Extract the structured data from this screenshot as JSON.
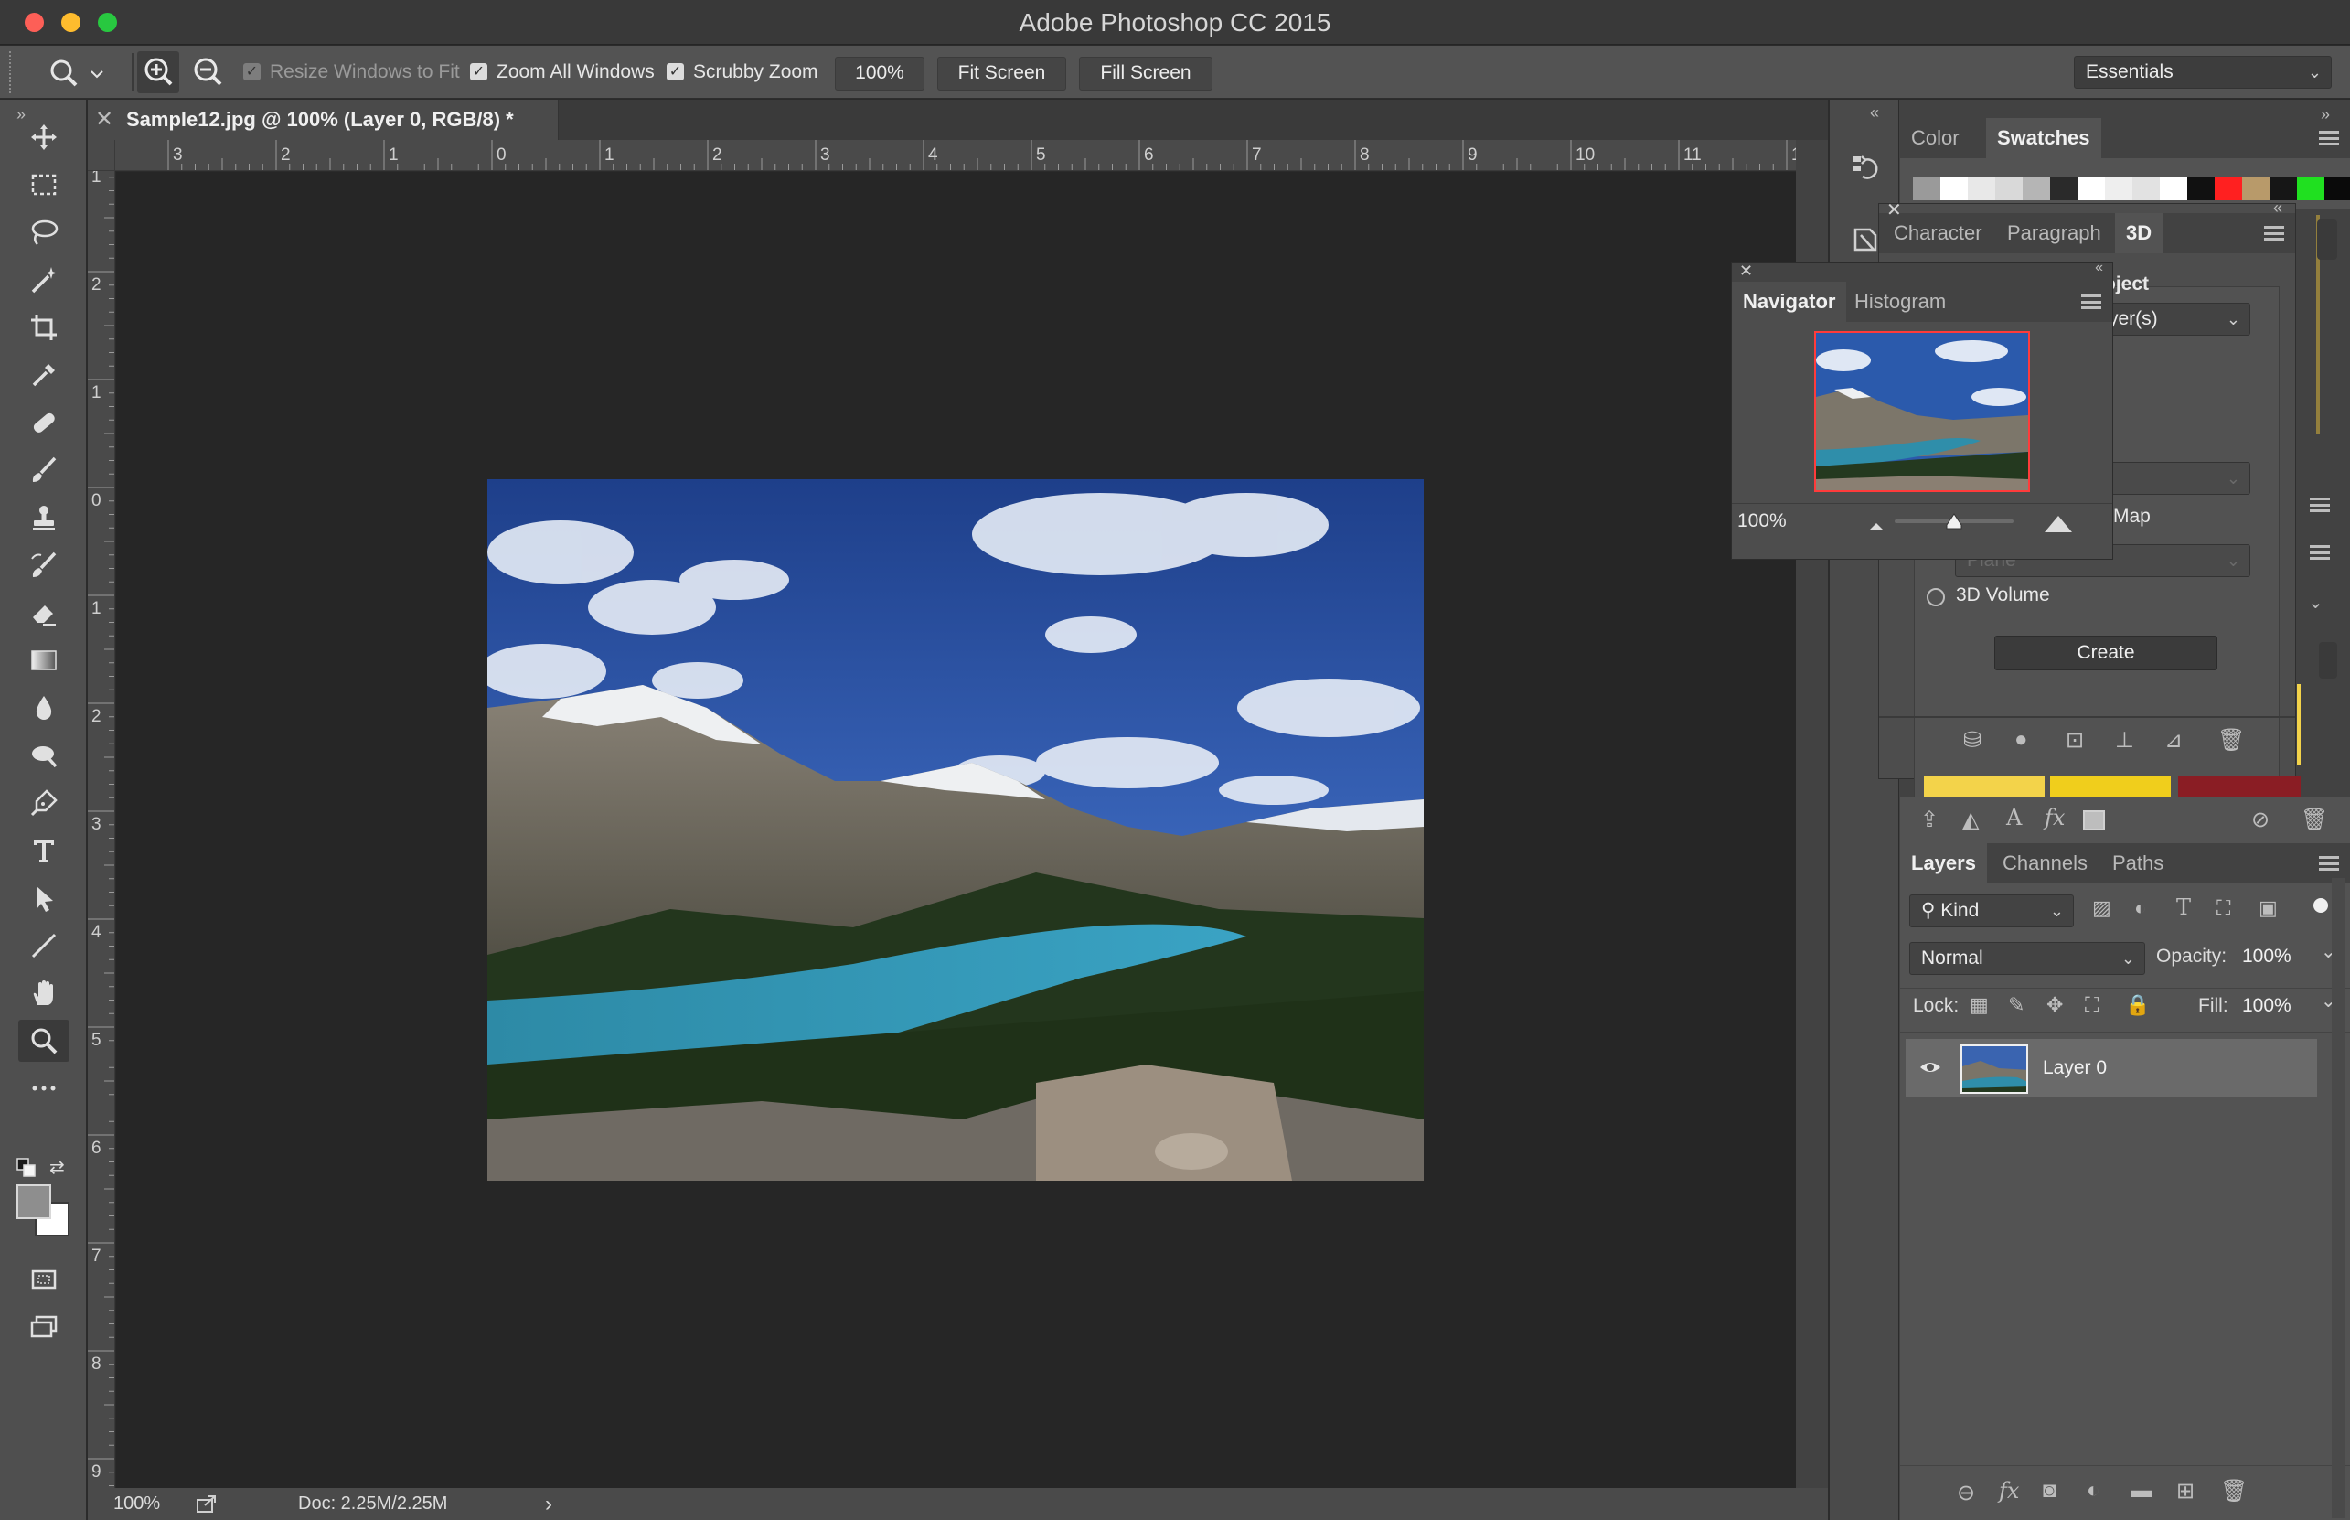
{
  "window": {
    "title": "Adobe Photoshop CC 2015"
  },
  "options_bar": {
    "resize_windows_label": "Resize Windows to Fit",
    "zoom_all_windows_label": "Zoom All Windows",
    "scrubby_zoom_label": "Scrubby Zoom",
    "zoom_value": "100%",
    "fit_screen_label": "Fit Screen",
    "fill_screen_label": "Fill Screen",
    "workspace": "Essentials",
    "resize_windows_checked": true,
    "zoom_all_windows_checked": true,
    "scrubby_zoom_checked": true
  },
  "document": {
    "tab_title": "Sample12.jpg @ 100% (Layer 0, RGB/8) *",
    "ruler_h": [
      "3",
      "2",
      "1",
      "0",
      "1",
      "2",
      "3",
      "4",
      "5",
      "6",
      "7",
      "8",
      "9",
      "10",
      "11",
      "1"
    ],
    "ruler_v": [
      "1",
      "2",
      "1",
      "0",
      "1",
      "2",
      "3",
      "4",
      "5",
      "6",
      "7",
      "8",
      "9"
    ]
  },
  "status_bar": {
    "zoom": "100%",
    "doc_size": "Doc: 2.25M/2.25M",
    "arrow": "›"
  },
  "color_panel": {
    "tabs": [
      "Color",
      "Swatches"
    ],
    "active_tab": "Swatches",
    "swatches": [
      "#9a9a9a",
      "#ffffff",
      "#e8e8e8",
      "#d9d9d9",
      "#b5b5b5",
      "#2a2a2a",
      "#ffffff",
      "#eeeeee",
      "#e2e2e2",
      "#ffffff",
      "#111111",
      "#ff2020",
      "#b89a6a",
      "#161616",
      "#20e020",
      "#0a0a0a"
    ]
  },
  "properties_panel": {
    "tabs": [
      "Character",
      "Paragraph",
      "3D"
    ],
    "active_tab": "3D",
    "object_label": "oject",
    "layers_dropdown": "yer(s)",
    "map_label": "Map",
    "volume_label": "3D Volume",
    "plane_value": "Plane",
    "create_button": "Create"
  },
  "navigator_panel": {
    "tabs": [
      "Navigator",
      "Histogram"
    ],
    "active_tab": "Navigator",
    "zoom": "100%",
    "zoom_slider_percent": 50
  },
  "layers_panel": {
    "tabs": [
      "Layers",
      "Channels",
      "Paths"
    ],
    "active_tab": "Layers",
    "filter_kind": "Kind",
    "blend_mode": "Normal",
    "opacity_label": "Opacity:",
    "opacity_value": "100%",
    "lock_label": "Lock:",
    "fill_label": "Fill:",
    "fill_value": "100%",
    "layers": [
      {
        "name": "Layer 0",
        "visible": true,
        "selected": true
      }
    ]
  },
  "colors": {
    "accent": "#3d3d3d",
    "yellow_swatch_1": "#f3d34a",
    "yellow_swatch_2": "#f0ce1c",
    "red_swatch": "#8a1d24"
  },
  "icons": {
    "close": "close-icon",
    "menu": "panel-menu-icon",
    "zoom_in": "zoom-in-icon",
    "zoom_out": "zoom-out-icon"
  }
}
